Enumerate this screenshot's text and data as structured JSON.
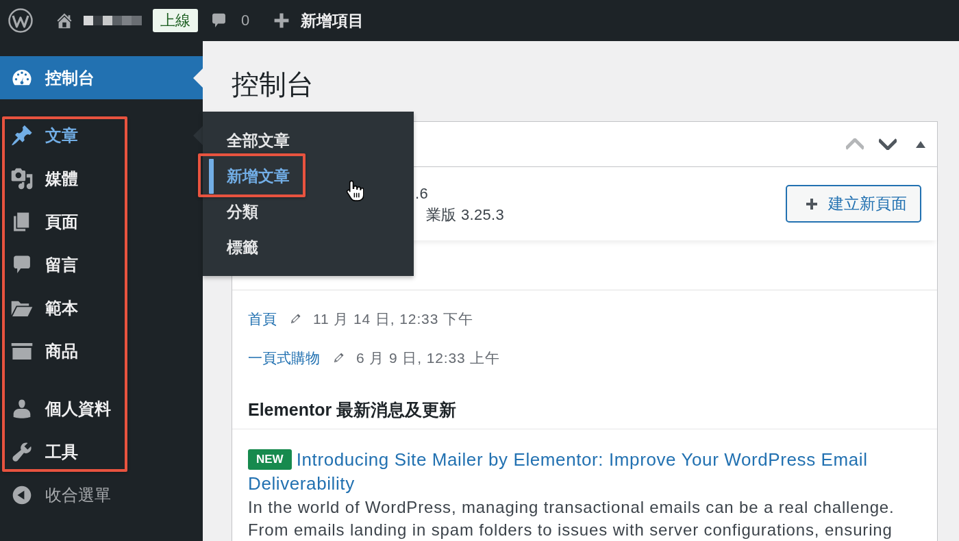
{
  "admin_bar": {
    "status_badge": "上線",
    "comment_count": "0",
    "new_item_label": "新增項目"
  },
  "sidebar": {
    "menu_groups": [
      {
        "framed": false,
        "sections": [
          {
            "items": [
              {
                "label": "控制台",
                "selected": true,
                "open": false
              }
            ]
          }
        ]
      },
      {
        "framed": true,
        "sections": [
          {
            "items": [
              {
                "label": "文章",
                "selected": false,
                "open": true,
                "submenu": {
                  "items": [
                    {
                      "label": "全部文章",
                      "selected": false,
                      "framed": false
                    },
                    {
                      "label": "新增文章",
                      "selected": true,
                      "framed": true
                    },
                    {
                      "label": "分類",
                      "selected": false,
                      "framed": false
                    },
                    {
                      "label": "標籤",
                      "selected": false,
                      "framed": false
                    }
                  ]
                }
              },
              {
                "label": "媒體",
                "selected": false,
                "open": false
              },
              {
                "label": "頁面",
                "selected": false,
                "open": false
              },
              {
                "label": "留言",
                "selected": false,
                "open": false
              },
              {
                "label": "範本",
                "selected": false,
                "open": false
              },
              {
                "label": "商品",
                "selected": false,
                "open": false
              }
            ]
          },
          {
            "items": [
              {
                "label": "個人資料",
                "selected": false,
                "open": false
              },
              {
                "label": "工具",
                "selected": false,
                "open": false
              }
            ]
          }
        ]
      }
    ],
    "collapse_button": {
      "label": "收合選單"
    }
  },
  "main": {
    "title": "控制台",
    "panel": {
      "header_controls": [
        {
          "disabled": true
        },
        {
          "disabled": false
        },
        {
          "disabled": false
        }
      ],
      "version_lines": [
        ".6",
        "業版 3.25.3"
      ],
      "create_button": "建立新頁面",
      "recent_items": [
        {
          "title": "首頁",
          "date": "11 月 14 日, 12:33 下午"
        },
        {
          "title": "一頁式購物",
          "date": "6 月 9 日, 12:33 上午"
        }
      ],
      "news_heading": "Elementor 最新消息及更新",
      "news": [
        {
          "badge": "NEW",
          "title": "Introducing Site Mailer by Elementor: Improve Your WordPress Email Deliverability",
          "excerpt": "In the world of WordPress, managing transactional emails can be a real challenge. From emails landing in spam folders to issues with server configurations, ensuring"
        }
      ]
    }
  }
}
